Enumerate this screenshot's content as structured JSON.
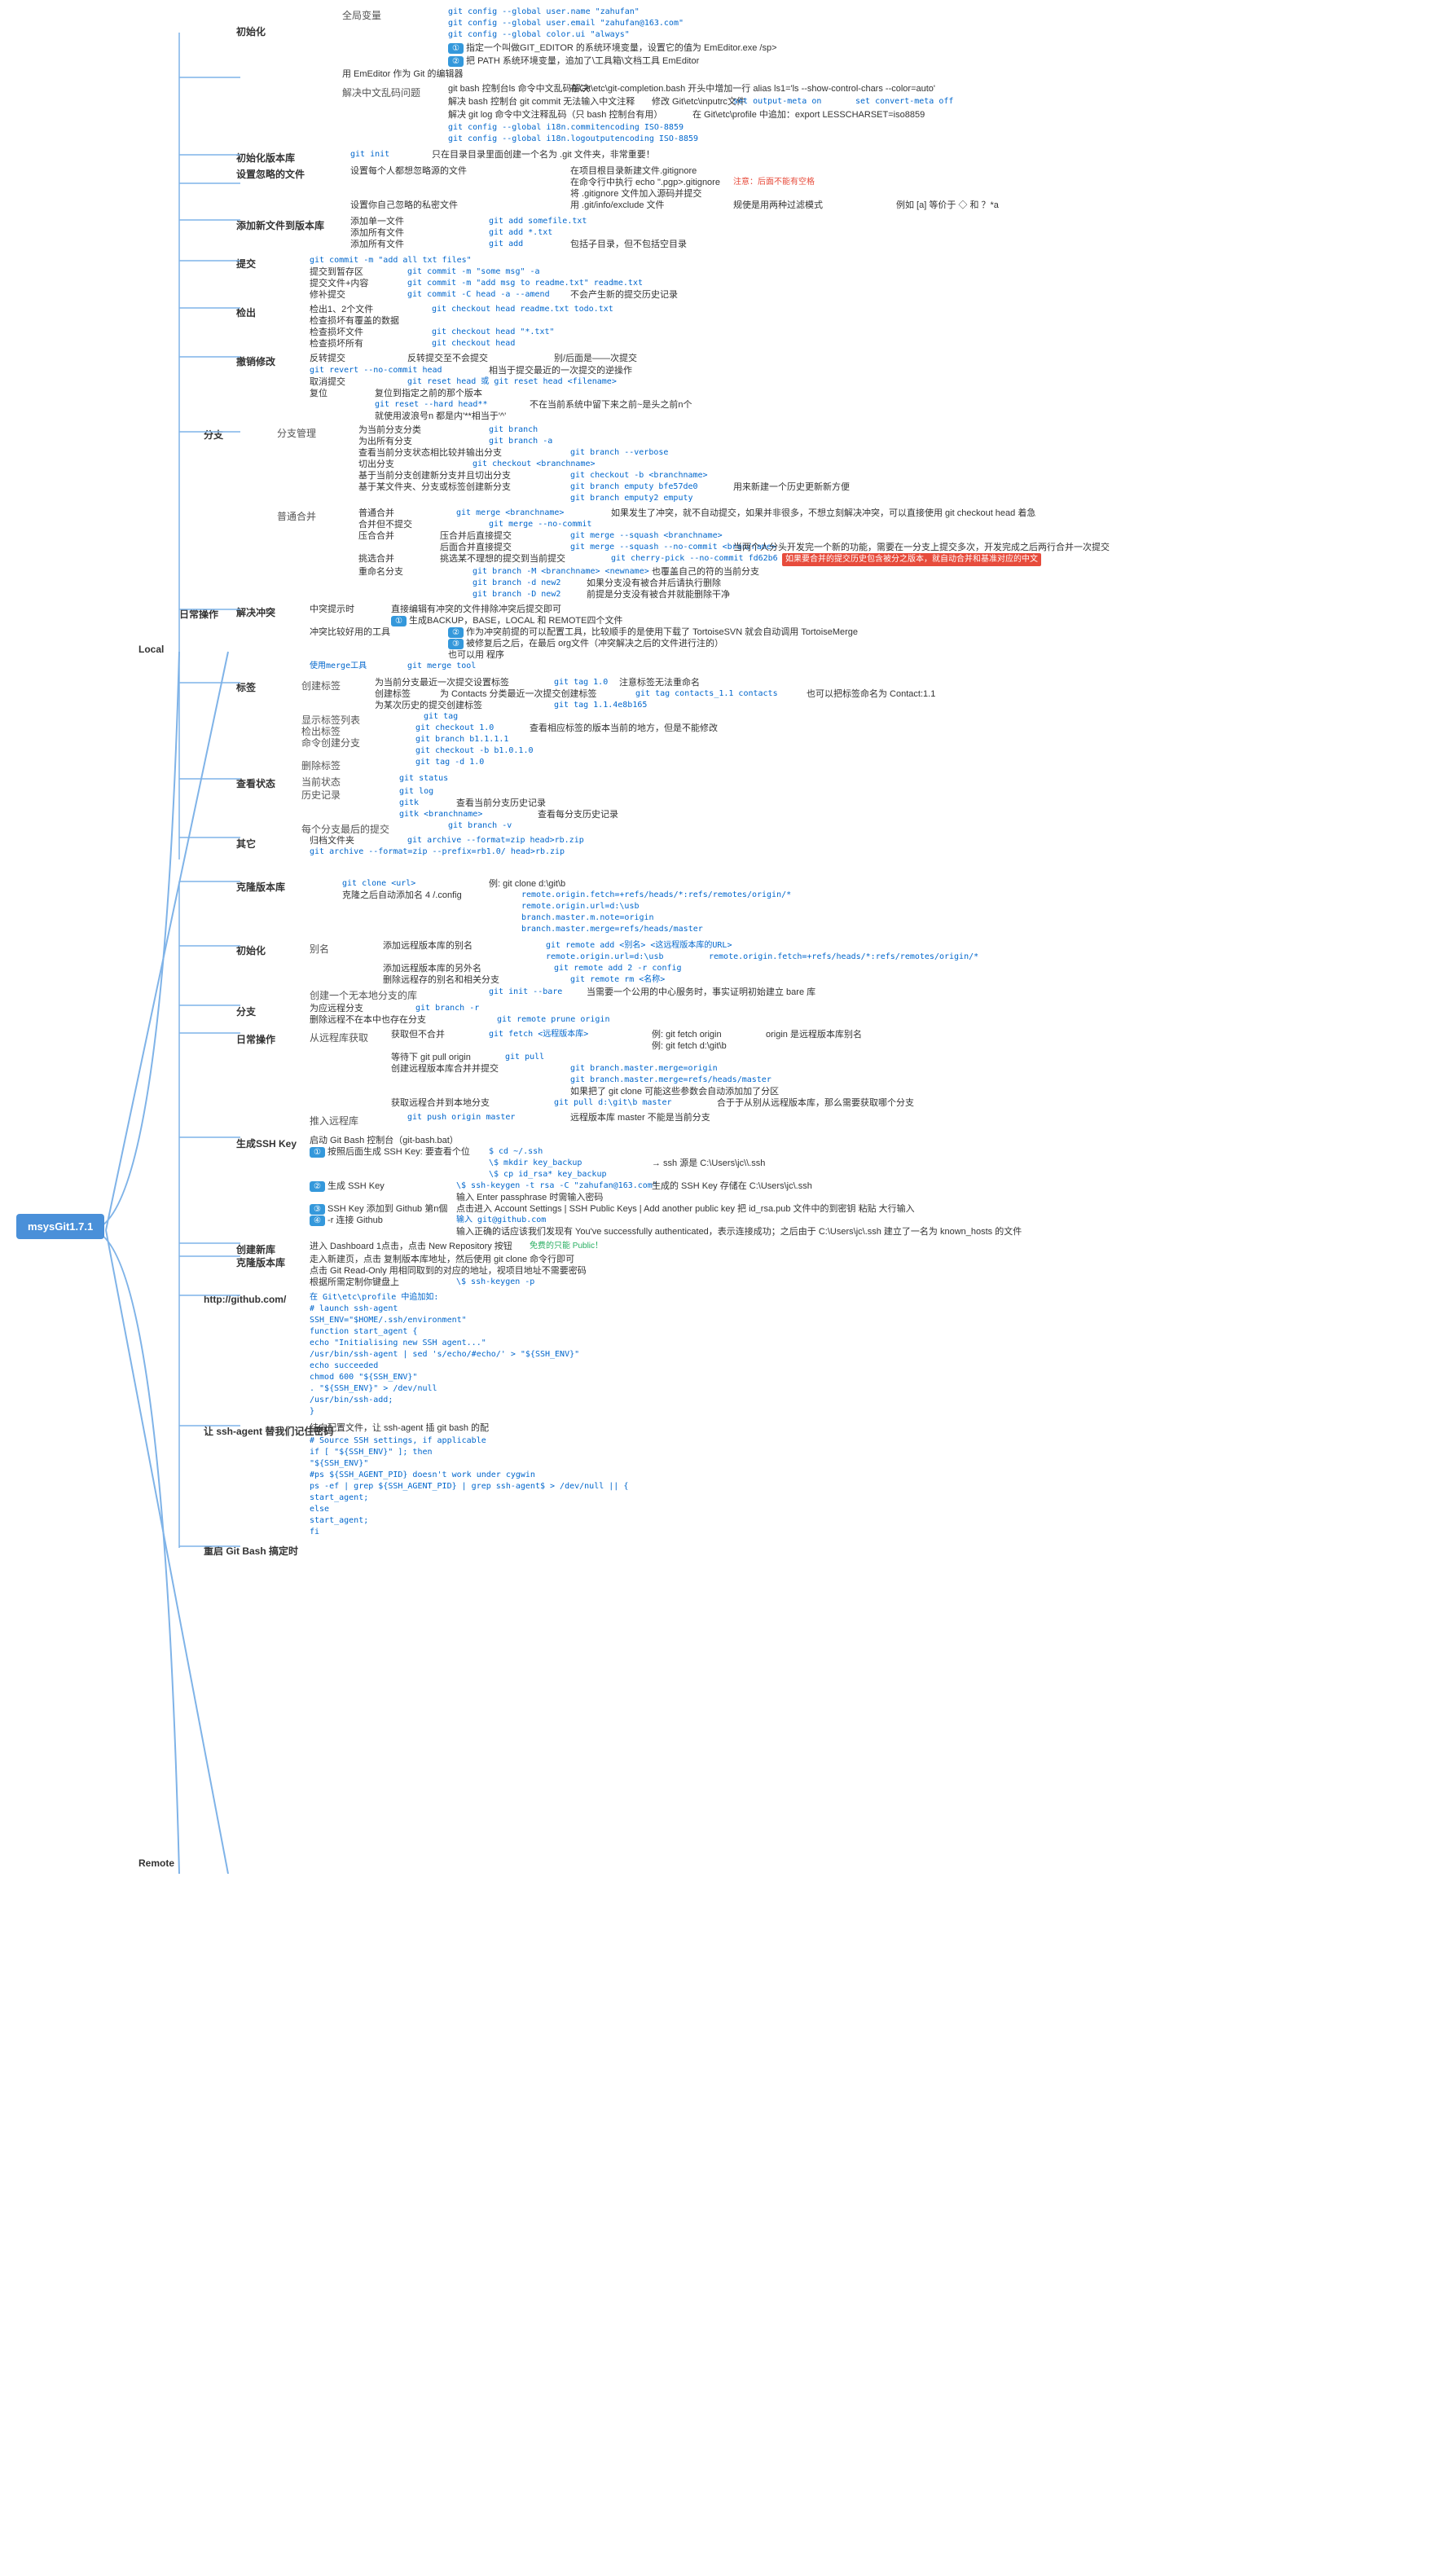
{
  "title": "msysGit1.7.1",
  "root": "msysGit1.7.1",
  "local_label": "Local",
  "remote_label": "Remote",
  "sections": {
    "local": {
      "label": "Local",
      "subsections": [
        {
          "name": "初始化",
          "items": [
            {
              "type": "group",
              "name": "全局变量",
              "items": [
                "git config --global user.name \"zahufan\"",
                "git config --global user.email \"zahufan@163.com\"",
                "git config --global color.ui \"always\"",
                "① 指定一个叫做GIT_EDITOR 的系统环境变量，设置它的值为 EmEditor.exe /sp>",
                "② 把 PATH 系统环境变量，追加了\\工具箱\\文档工具 EmEditor",
                "用 EmEditor 作为 Git 的编辑器"
              ]
            },
            {
              "type": "group",
              "name": "解决中文乱码问题",
              "items": [
                "git bash 控制台ls 命令中文乱码解决",
                "在Git\\etc\\git-completion.bash 开头中增加一行 alias ls1='ls --show-control-chars --color=auto'",
                "解决 bash 控制台 git commit 无法输入中文注释",
                "修改 Git\\etc\\inputrc文件",
                "set output-meta on",
                "set convert-meta off",
                "解决 git log 命令中文注释乱码（只 bash 控制台有用）",
                "在 Git\\etc\\profile 中追加：export LESSCHARSET=iso8859",
                "git config --global i18n.commitencoding ISO-8859",
                "git config --global i18n.logoutputencoding ISO-8859"
              ]
            }
          ]
        },
        {
          "name": "初始化版本库",
          "items": [
            "git init",
            "只在目录目录里面创建一个名为 .git 文件夹，非常重要！"
          ]
        },
        {
          "name": "设置忽略的文件",
          "items": [
            "设置每个人都想忽略源的文件",
            "在项目根目录新建文件.gitignore",
            "在命令行中执行 echo \".pgp>.gitignore",
            "注意：后面不能有空格",
            "将 .gitignore 文件加入源码并提交",
            "设置你自己忽略的私密文件",
            "用 .git/info/exclude 文件",
            "规使是用两种过滤模式",
            "例如 [a] 等价于 ◇ 和 ？*a"
          ]
        },
        {
          "name": "添加新文件到版本库",
          "items": [
            "添加单一文件",
            "git add somefile.txt",
            "添加所有文件",
            "git add *.txt",
            "添加所有文件",
            "git add",
            "包括子目录，但不包括空目录"
          ]
        },
        {
          "name": "提交",
          "items": [
            "git commit -m \"add all txt files\"",
            "提交到暂存区",
            "git commit -m \"some msg\" -a",
            "提交文件+内容",
            "git commit -m \"add msg to readme.txt\" readme.txt",
            "修补提交",
            "git commit -C head -a --amend",
            "不会产生新的提交历史记录"
          ]
        },
        {
          "name": "检出",
          "items": [
            "检出1、2个文件",
            "git checkout head readme.txt todo.txt",
            "检查损坏有覆盖的数据",
            "检查损坏文件",
            "git checkout head \"*.txt\"",
            "检查损坏所有",
            "git checkout head"
          ]
        },
        {
          "name": "撤销修改",
          "items": [
            "反转提交",
            "反转提交至不会提交",
            "别/后面是——次提交",
            "git revert --no-commit head",
            "相当于提交最近的一次提交的逆操作",
            "取消提交",
            "git reset head 或 git reset head <filename>",
            "复位",
            "复位到指定之前的那个版本",
            "git reset --hard head**",
            "不在当前系统中留下来之前~是头之前n个",
            "就使用波浪号n 都是内'**相当于'^'"
          ]
        },
        {
          "name": "分支",
          "sub_items": [
            {
              "name": "分支管理",
              "items": [
                "为当前分支分类",
                "git branch",
                "为出所有分支",
                "git branch -a",
                "查看当前分支状态相比较并输出分支",
                "git branch --verbose",
                "切出分支",
                "git checkout <branchname>",
                "基于当前分支创建新分支并且切出分支",
                "git checkout -b <branchname>",
                "基于某文件夹、分支或标签创建新分支",
                "git branch emputy bfe57de0",
                "用来新建一个历史更新新方便",
                "git branch emputy2 emputy"
              ]
            },
            {
              "name": "普通合并",
              "items": [
                "普通合并",
                "git merge <branchname>",
                "如果发生了冲突，就不自动提交，如果并非很多，不想立刻解决冲突，可以直接使用 git checkout head  着急",
                "合并但不提交",
                "git merge --no-commit",
                "压合合并",
                "压合并后直接提交",
                "git merge --squash <branchname>",
                "后面合并直接提交",
                "git merge --squash --no-commit <bran/name>",
                "当两个人分头开发完一个新的功能，需要在一分支上提交多次，开发完成之后两行合并一次提交",
                "挑选合并",
                "挑选某不理想的提交到当前提交",
                "git cherry-pick --no-commit fd62b6",
                "如果要合并的提交历史包含被分之版本，就自动合并和基准对应的中文",
                "重命名分支",
                "git branch -M <branchname> <newname>",
                "也覆盖自己的符的当前分支",
                "git branch -d new2",
                "如果分支没有被合并后请执行删除",
                "git branch -D new2",
                "前提是分支没有被合并就能删除干净"
              ]
            }
          ]
        }
      ]
    },
    "daily_ops": {
      "name": "日常操作",
      "subsections": [
        {
          "name": "解决冲突",
          "items": [
            "中突提示时",
            "直接编辑有冲突的文件排除冲突后提交即可",
            "① 生成BACKUP，BASE，LOCAL 和 REMOTE四个文件",
            "冲突比较好用的工具",
            "② 作为冲突前提的可以配置工具，比较顺手的是使用下载了 TortoiseSVN 就会自动调用 TortoiseMerge",
            "③ 被修复后之后，在最后 org文件（冲突解决之后的文件进行注的）",
            "也可以用 程序",
            "使用merge工具"
          ]
        },
        {
          "name": "标签",
          "sub_items": [
            {
              "name": "创建标签",
              "items": [
                "为当前分支最近一次提交设置标签",
                "git tag 1.0",
                "注意标签无法重命名",
                "创建标签",
                "为 Contacts 分类最近一次提交创建标签",
                "git tag contacts_1.1 contacts",
                "也可以把标签命名为 Contact:1.1",
                "为某次历史的提交创建标签",
                "git tag 1.1.4e8b165"
              ]
            },
            {
              "name": "显示标签列表",
              "items": [
                "git tag"
              ]
            },
            {
              "name": "检出标签",
              "items": [
                "git checkout 1.0",
                "查看相应标签的版本当前的地方，但是不能修改"
              ]
            },
            {
              "name": "命令创建分支",
              "items": [
                "git branch b1.1.1.1",
                "git checkout -b b1.0.1.0"
              ]
            },
            {
              "name": "删除标签",
              "items": [
                "git tag -d 1.0"
              ]
            }
          ]
        },
        {
          "name": "查看状态",
          "sub_items": [
            {
              "name": "当前状态",
              "items": [
                "git status"
              ]
            },
            {
              "name": "历史记录",
              "items": [
                "git log",
                "gitk",
                "查看当前分支历史记录",
                "gitk <branchname>",
                "查看每分支历史记录"
              ]
            },
            {
              "name": "每个分支最后的提交",
              "items": [
                "git branch -v"
              ]
            }
          ]
        },
        {
          "name": "其它",
          "items": [
            "归档文件夹",
            "git archive --format=zip head>rb.zip",
            "git archive --format=zip --prefix=rb1.0/ head>rb.zip"
          ]
        }
      ]
    },
    "remote": {
      "name": "Remote",
      "subsections": [
        {
          "name": "克隆版本库",
          "items": [
            "git clone <url>",
            "例: git clone d:\\git\\b",
            "克隆之后自动添加名 4 /-config",
            "remote.origin.fetch=+refs/heads/*:refs/remotes/origin/*",
            "remote.origin.url=d:\\usb",
            "branch.master.m.note=origin",
            "branch.master.merge=refs/heads/master"
          ]
        },
        {
          "name": "初始化",
          "sub_items": [
            {
              "name": "别名",
              "items": [
                "添加远程版本库的别名",
                "git remote add <别名> <这远程版本库的URL>",
                "remote.origin.url=d:\\usb",
                "remote.origin.fetch=+refs/heads/*:refs/remotes/origin/*",
                "添加远程版本库的另外名",
                "git remote add 2 -r config",
                "删除远程存的别名和相关分支",
                "git remote rm <名称>"
              ]
            },
            {
              "name": "创建一个本地分支的库",
              "items": [
                "git init --bare",
                "当需要一个公用的中心服务时，事实证明初始建立 bare 库"
              ]
            }
          ]
        },
        {
          "name": "分支",
          "items": [
            "为应远程分支",
            "git branch -r",
            "删除远程不在本中也存在分支",
            "git remote prune origin"
          ]
        },
        {
          "name": "日常操作",
          "sub_items": [
            {
              "name": "从远程库获取",
              "items": [
                "获取但不合并",
                "git fetch <远程版本库>",
                "例: git fetch origin",
                "origin 是远程版本库别名",
                "例: git fetch d:\\git\\b",
                "等待下 git pull origin",
                "git pull",
                "创建远程版本库合并并提交",
                "git branch.master.merge=origin",
                "git branch.master.merge=refs/heads/master",
                "如果把了 git clone 可能这些参数会自动添加加了分区",
                "获取远程合并到本地分支",
                "git pull d:\\git\\b master",
                "合于于从别从远程版本库，那么需要获取哪个分支"
              ]
            },
            {
              "name": "推入远程库",
              "items": [
                "git push origin master",
                "远程版本库 master 不能是当前分支"
              ]
            }
          ]
        },
        {
          "name": "生成SSH Key",
          "items": [
            "启动 Git Bash 控制台（git-bash.bat）",
            "① 按照后面生成 SSH Key: 要查看个位",
            "$ cd ~/.ssh",
            "\\$ mkdir key_backup",
            "\\$ cp id_rsa* key_backup",
            "→ ssh 源是 C:\\Users\\jc\\\\ssh",
            "② 生成 SSH Key",
            "\\$ ssh-keygen -t rsa -C \"zahufan@163.com\"",
            "生成的 SSH Key 存储在 C:\\Users\\jc\\.ssh",
            "输入 Enter passphrase 时需输入密码",
            "③ SSH Key 添加到 Github 第n個",
            "点击进入 Account Settings | SSH Public Keys | Add another public key  把 id_rsa.pub 文件中的到密钥 粘贴 大行输入",
            "④ -r 连接 Github",
            "输入 git@github.com",
            "输入正确的话应该我们发现有 You've successfully authenticated，表示连接成功；之后由于 C:\\Users\\jc\\.ssh 建立了一名为 known_hosts 的文件"
          ]
        },
        {
          "name": "创建新库",
          "items": [
            "进入 Dashboard 1点击，点击 New Repository 按钮",
            "免费的只能 Public！"
          ]
        },
        {
          "name": "克隆版本库",
          "items": [
            "走入新建页，点击 复制版本库地址，然后使用 git clone 命令行即可",
            "点击 Git Read-Only 用相同取到的对应的地址，视项目地址不需要密码",
            "根据所需定制你键盘上",
            "\\$ ssh-keygen -p"
          ]
        },
        {
          "name": "http://github.com/",
          "items": [
            "在 Git\\etc\\profile 中追加如:",
            "# launch ssh-agent",
            "SSH_ENV=\"$HOME/.ssh/environment\"",
            "function start_agent {",
            "echo \"Initialising new SSH agent...\"",
            "/usr/bin/ssh-agent | sed 's/echo/#echo/' > \"${SSH_ENV}\"",
            "echo succeeded",
            "chmod 600 \"${SSH_ENV}\"",
            ". \"${SSH_ENV}\" > /dev/null",
            "/usr/bin/ssh-add;",
            "}"
          ]
        },
        {
          "name": "让 ssh-agent 替我们记住密码",
          "items": [
            "结向配置文件，让 ssh-agent 插 git bash 的配",
            "# Source SSH settings, if applicable",
            "if [ \"${SSH_ENV}\" ]; then",
            "\"${SSH_ENV}\"",
            "#ps ${SSH_AGENT_PID} doesn't work under cygwin",
            "ps -ef | grep ${SSH_AGENT_PID} | grep ssh-agent$ > /dev/null || {",
            "start_agent;",
            "else",
            "start_agent;",
            "fi"
          ]
        },
        {
          "name": "重启 Git Bash 搞定时",
          "items": []
        }
      ]
    }
  }
}
